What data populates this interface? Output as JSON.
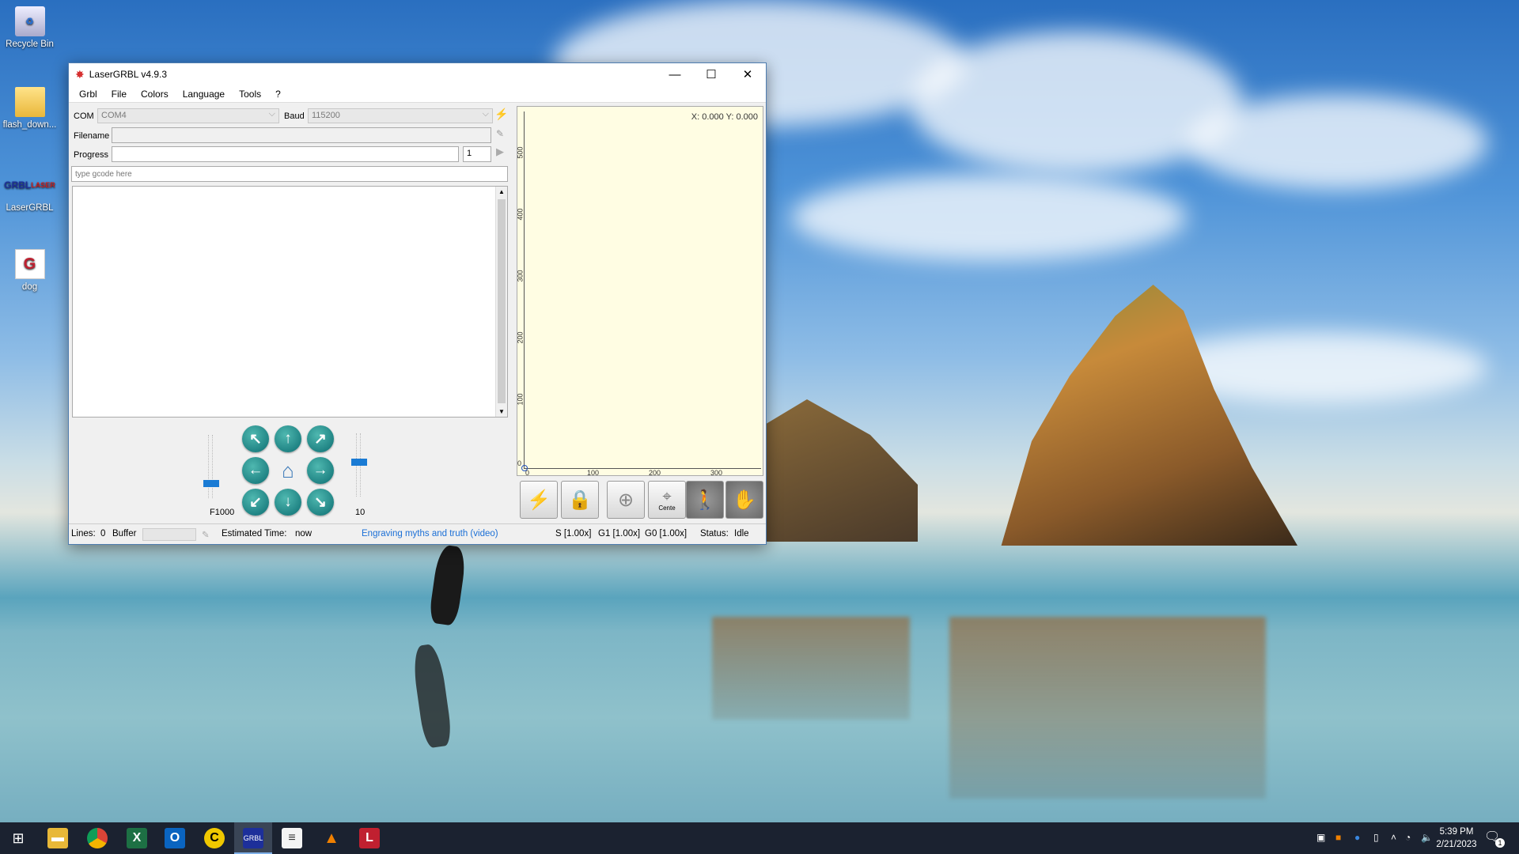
{
  "desktop": {
    "icons": [
      {
        "label": "Recycle Bin",
        "icon": "recycle-bin-icon"
      },
      {
        "label": "flash_down...",
        "icon": "folder-icon"
      },
      {
        "label": "LaserGRBL",
        "icon": "lasergrbl-app-icon"
      },
      {
        "label": "dog",
        "icon": "lightburn-file-icon"
      }
    ]
  },
  "window": {
    "title": "LaserGRBL v4.9.3",
    "menu": [
      "Grbl",
      "File",
      "Colors",
      "Language",
      "Tools",
      "?"
    ],
    "com_label": "COM",
    "com_value": "COM4",
    "baud_label": "Baud",
    "baud_value": "115200",
    "filename_label": "Filename",
    "filename_value": "",
    "progress_label": "Progress",
    "progress_fraction": 0,
    "copies_value": "1",
    "gcode_placeholder": "type gcode here",
    "feed_label": "F1000",
    "step_label": "10",
    "feed_slider_fraction": 0.2,
    "step_slider_fraction": 0.55,
    "coords": "X: 0.000 Y: 0.000",
    "y_ticks": [
      "500",
      "400",
      "300",
      "200",
      "100",
      "0"
    ],
    "x_ticks": [
      "0",
      "100",
      "200",
      "300"
    ],
    "tool_buttons": [
      {
        "name": "reset-button",
        "icon": "lightning-icon"
      },
      {
        "name": "unlock-button",
        "icon": "lock-icon"
      },
      {
        "name": "homing-button",
        "icon": "globe-icon"
      },
      {
        "name": "center-button",
        "icon": "crosshair-icon",
        "label": "Cente"
      },
      {
        "name": "walk-button",
        "icon": "walking-person-icon"
      },
      {
        "name": "stop-button",
        "icon": "hand-icon"
      }
    ],
    "status": {
      "lines_label": "Lines:",
      "lines_value": "0",
      "buffer_label": "Buffer",
      "est_label": "Estimated Time:",
      "est_value": "now",
      "link": "Engraving myths and truth (video)",
      "s_override": "S [1.00x]",
      "g1_override": "G1 [1.00x]",
      "g0_override": "G0 [1.00x]",
      "status_label": "Status:",
      "status_value": "Idle"
    }
  },
  "taskbar": {
    "apps": [
      "start-icon",
      "file-explorer-icon",
      "chrome-icon",
      "excel-icon",
      "outlook-icon",
      "cura-icon",
      "lasergrbl-taskbar-icon",
      "notepad-icon",
      "vlc-icon",
      "lightburn-icon"
    ],
    "time": "5:39 PM",
    "date": "2/21/2023",
    "notification_count": "1"
  },
  "colors": {
    "accent": "#1a7bd4",
    "plot_bg": "#fffde3",
    "link": "#1a6fd6"
  }
}
